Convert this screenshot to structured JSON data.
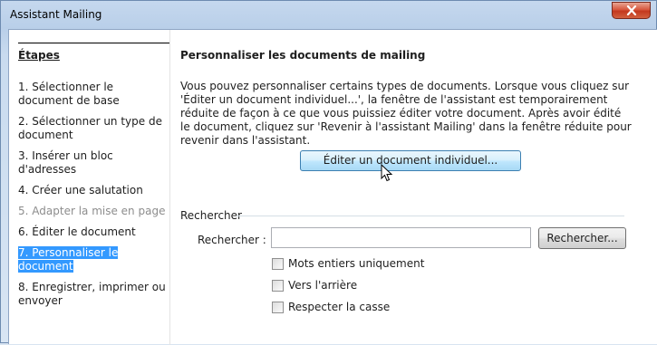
{
  "window": {
    "title": "Assistant Mailing"
  },
  "steps": {
    "title": "Étapes",
    "items": [
      {
        "num": "1.",
        "label": "Sélectionner le document de base",
        "state": "normal"
      },
      {
        "num": "2.",
        "label": "Sélectionner un type de document",
        "state": "normal"
      },
      {
        "num": "3.",
        "label": "Insérer un bloc d'adresses",
        "state": "normal"
      },
      {
        "num": "4.",
        "label": "Créer une salutation",
        "state": "normal"
      },
      {
        "num": "5.",
        "label": "Adapter la mise en page",
        "state": "disabled"
      },
      {
        "num": "6.",
        "label": "Éditer le document",
        "state": "normal"
      },
      {
        "num": "7.",
        "label": "Personnaliser le document",
        "state": "selected"
      },
      {
        "num": "8.",
        "label": "Enregistrer, imprimer ou envoyer",
        "state": "normal"
      }
    ]
  },
  "main": {
    "heading": "Personnaliser les documents de mailing",
    "description": "Vous pouvez personnaliser certains types de documents. Lorsque vous cliquez sur 'Éditer un document individuel...', la fenêtre de l'assistant est temporairement réduite de façon à ce que vous puissiez éditer votre document. Après avoir édité le document, cliquez sur 'Revenir à l'assistant Mailing' dans la fenêtre réduite pour revenir dans l'assistant.",
    "edit_button": "Éditer un document individuel..."
  },
  "search": {
    "group_label": "Rechercher",
    "field_label": "Rechercher :",
    "value": "",
    "button": "Rechercher...",
    "options": [
      {
        "label": "Mots entiers uniquement",
        "checked": false
      },
      {
        "label": "Vers l'arrière",
        "checked": false
      },
      {
        "label": "Respecter la casse",
        "checked": false
      }
    ]
  }
}
